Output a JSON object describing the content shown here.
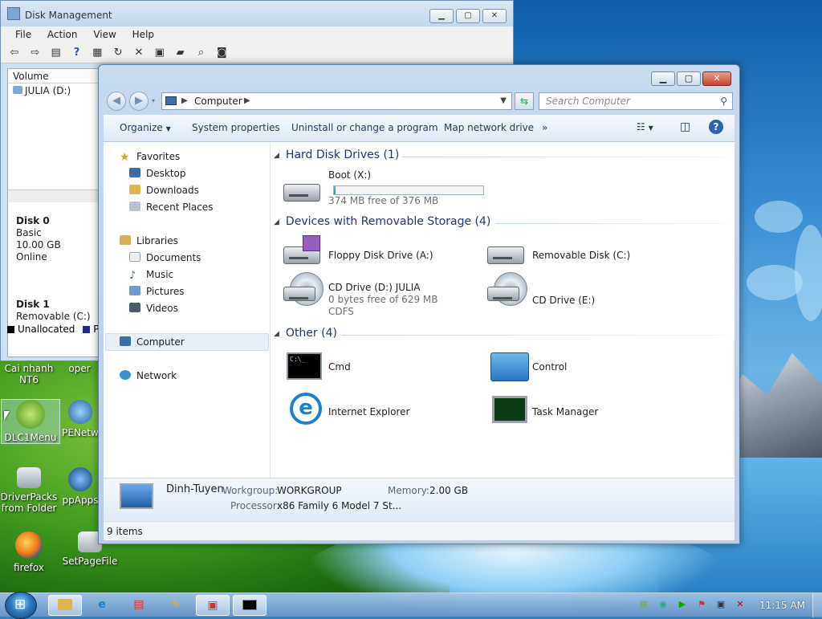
{
  "disk_mgmt": {
    "title": "Disk Management",
    "menu": [
      "File",
      "Action",
      "View",
      "Help"
    ],
    "col_volume": "Volume",
    "volume_row": "JULIA (D:)",
    "disk0": {
      "name": "Disk 0",
      "type": "Basic",
      "size": "10.00 GB",
      "status": "Online"
    },
    "disk1": {
      "name": "Disk 1",
      "type": "Removable (C:)"
    },
    "legend": {
      "unallocated": "Unallocated",
      "primary": "P"
    }
  },
  "desktop_icons": {
    "cai_nhanh": "Cai nhanh NT6",
    "oper": "oper",
    "dlc1menu": "DLC1Menu",
    "penetwork": "PENetw",
    "driverpacks": "DriverPacks from Folder",
    "ppapps": "ppApps",
    "firefox": "firefox",
    "setpagefile": "SetPageFile"
  },
  "explorer": {
    "address": "Computer",
    "search_placeholder": "Search Computer",
    "commands": {
      "organize": "Organize",
      "system_properties": "System properties",
      "uninstall": "Uninstall or change a program",
      "map_drive": "Map network drive",
      "more": "»"
    },
    "nav": {
      "favorites": "Favorites",
      "desktop": "Desktop",
      "downloads": "Downloads",
      "recent": "Recent Places",
      "libraries": "Libraries",
      "documents": "Documents",
      "music": "Music",
      "pictures": "Pictures",
      "videos": "Videos",
      "computer": "Computer",
      "network": "Network"
    },
    "groups": {
      "hdd": "Hard Disk Drives (1)",
      "removable": "Devices with Removable Storage (4)",
      "other": "Other (4)"
    },
    "items": {
      "boot": {
        "name": "Boot (X:)",
        "free": "374 MB free of 376 MB",
        "used_fraction": 0.005
      },
      "floppy": {
        "name": "Floppy Disk Drive (A:)"
      },
      "removable": {
        "name": "Removable Disk (C:)"
      },
      "cd_d": {
        "name": "CD Drive (D:) JULIA",
        "free": "0 bytes free of 629 MB",
        "fs": "CDFS"
      },
      "cd_e": {
        "name": "CD Drive (E:)"
      },
      "cmd": {
        "name": "Cmd"
      },
      "control": {
        "name": "Control"
      },
      "ie": {
        "name": "Internet Explorer"
      },
      "taskmgr": {
        "name": "Task Manager"
      }
    },
    "details": {
      "computer_name": "Dinh-Tuyen",
      "workgroup_label": "Workgroup:",
      "workgroup": "WORKGROUP",
      "memory_label": "Memory:",
      "memory": "2.00 GB",
      "processor_label": "Processor:",
      "processor": "x86 Family 6 Model 7 St..."
    },
    "status": "9 items"
  },
  "taskbar": {
    "clock": "11:15 AM"
  },
  "colors": {
    "accent": "#1e3287",
    "progress": "#1b8fd0",
    "link": "#1e395b"
  }
}
